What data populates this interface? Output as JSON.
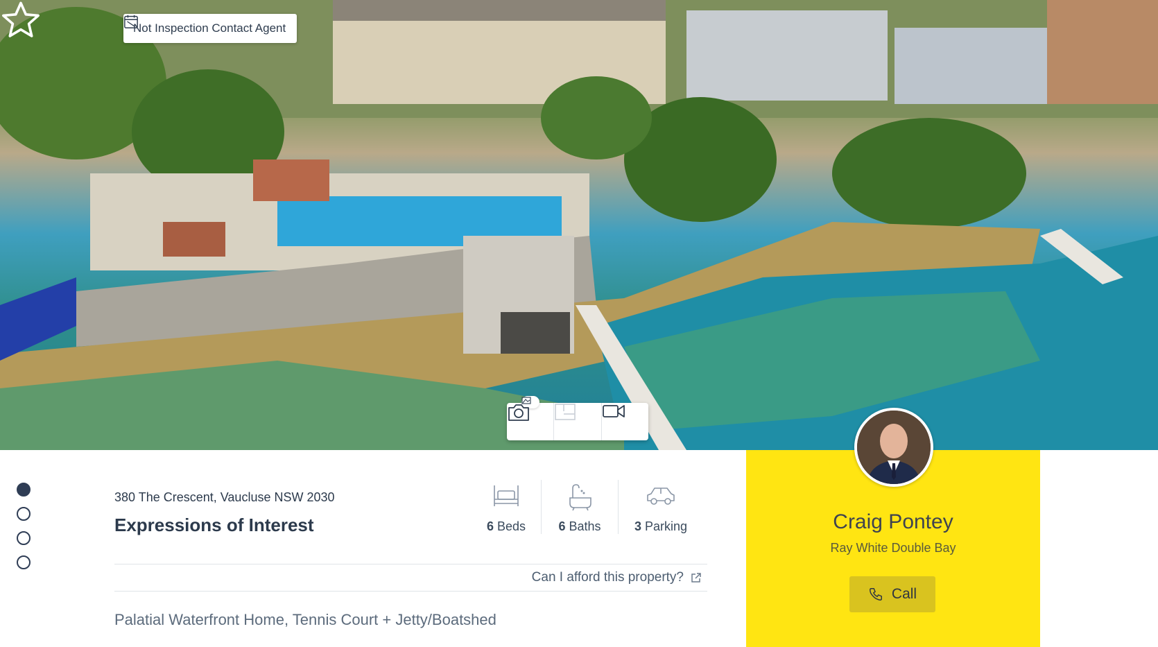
{
  "hero": {
    "inspection_label": "Not Inspection Contact Agent",
    "media_tabs": [
      {
        "name": "photos",
        "icon": "camera-icon",
        "active": true
      },
      {
        "name": "floorplan",
        "icon": "floorplan-icon",
        "active": false
      },
      {
        "name": "video",
        "icon": "video-icon",
        "active": false
      }
    ]
  },
  "listing": {
    "address": "380 The Crescent, Vaucluse NSW 2030",
    "headline": "Expressions of Interest",
    "features": {
      "beds": {
        "count": "6",
        "label": "Beds"
      },
      "baths": {
        "count": "6",
        "label": "Baths"
      },
      "parking": {
        "count": "3",
        "label": "Parking"
      }
    },
    "afford_link": "Can I afford this property?",
    "tagline": "Palatial Waterfront Home, Tennis Court + Jetty/Boatshed"
  },
  "pagination": {
    "total": 4,
    "active_index": 0
  },
  "agent": {
    "name": "Craig Pontey",
    "office": "Ray White Double Bay",
    "call_label": "Call"
  },
  "colors": {
    "accent_yellow": "#ffe512",
    "call_button": "#d9c31f",
    "navy": "#2f3d55"
  }
}
